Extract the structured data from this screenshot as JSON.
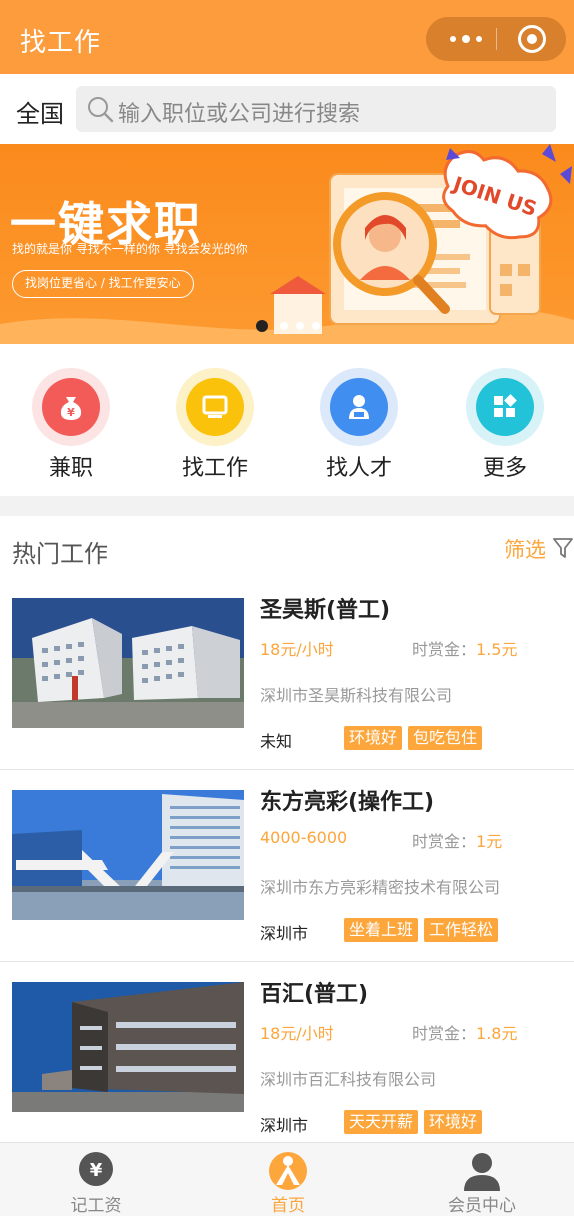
{
  "header": {
    "title": "找工作"
  },
  "search": {
    "region": "全国",
    "placeholder": "输入职位或公司进行搜索"
  },
  "banner": {
    "headline": "一键求职",
    "slogan": "找的就是你 寻找不一样的你 寻找会发光的你",
    "pill": "找岗位更省心 / 找工作更安心",
    "badge": "JOIN US",
    "slides": 4,
    "active_slide": 1
  },
  "quick_menu": [
    {
      "label": "兼职",
      "icon": "money-bag-icon",
      "color": "#f25b58",
      "ring": "#fde4e4"
    },
    {
      "label": "找工作",
      "icon": "monitor-icon",
      "color": "#fbc20c",
      "ring": "#fdf1c8"
    },
    {
      "label": "找人才",
      "icon": "person-icon",
      "color": "#3f8ef0",
      "ring": "#dbe9fb"
    },
    {
      "label": "更多",
      "icon": "grid-icon",
      "color": "#22c2d8",
      "ring": "#d7f3f7"
    }
  ],
  "hot_jobs": {
    "heading": "热门工作",
    "filter_label": "筛选",
    "bounty_label": "时赏金：",
    "items": [
      {
        "name": "圣昊斯(普工)",
        "salary": "18元/小时",
        "bounty": "1.5元",
        "company": "深圳市圣昊斯科技有限公司",
        "city": "未知",
        "tags": [
          "环境好",
          "包吃包住"
        ]
      },
      {
        "name": "东方亮彩(操作工)",
        "salary": "4000-6000",
        "bounty": "1元",
        "company": "深圳市东方亮彩精密技术有限公司",
        "city": "深圳市",
        "tags": [
          "坐着上班",
          "工作轻松"
        ]
      },
      {
        "name": "百汇(普工)",
        "salary": "18元/小时",
        "bounty": "1.8元",
        "company": "深圳市百汇科技有限公司",
        "city": "深圳市",
        "tags": [
          "天天开薪",
          "环境好"
        ]
      }
    ]
  },
  "tabbar": {
    "items": [
      {
        "label": "记工资",
        "icon": "yen-icon"
      },
      {
        "label": "首页",
        "icon": "home-person-icon",
        "active": true
      },
      {
        "label": "会员中心",
        "icon": "member-icon"
      }
    ]
  },
  "colors": {
    "brand": "#fc9c3c",
    "accent": "#fca63c",
    "muted": "#999999"
  }
}
